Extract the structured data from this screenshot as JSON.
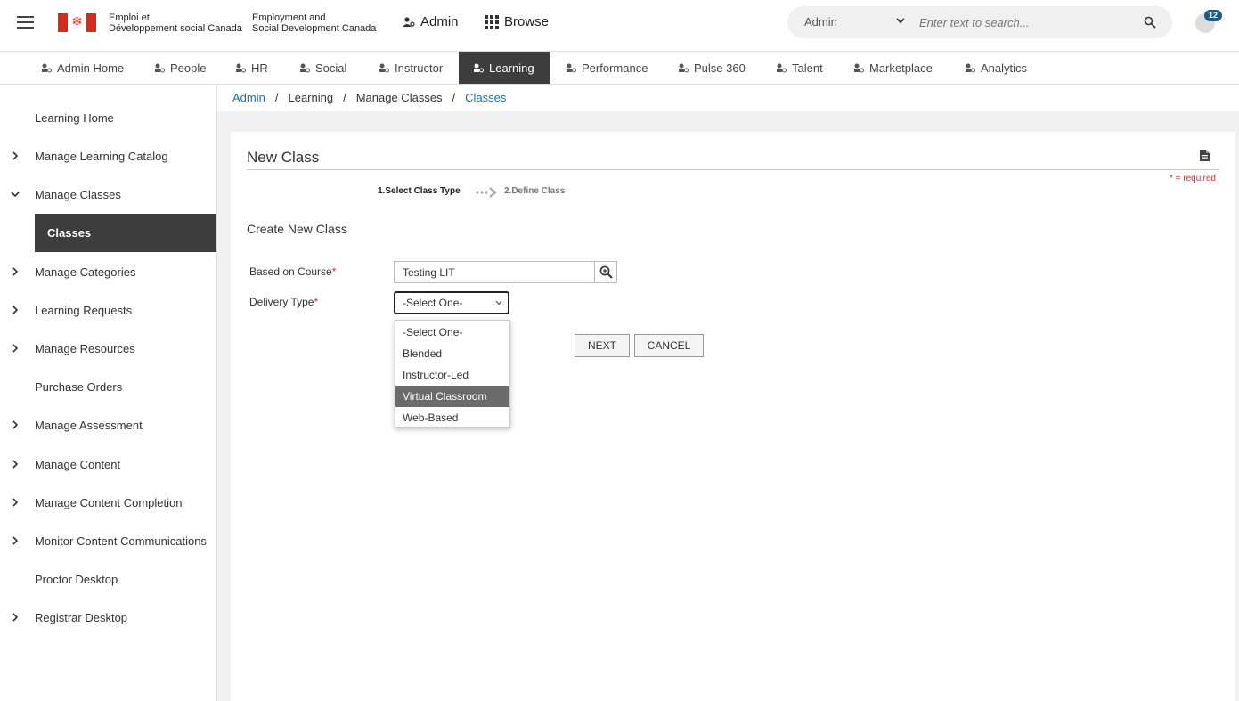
{
  "header": {
    "gov_fr_line1": "Emploi et",
    "gov_fr_line2": "Développement social Canada",
    "gov_en_line1": "Employment and",
    "gov_en_line2": "Social Development Canada",
    "admin_label": "Admin",
    "browse_label": "Browse",
    "search_scope": "Admin",
    "search_placeholder": "Enter text to search...",
    "notification_count": "12"
  },
  "nav": {
    "items": [
      {
        "label": "Admin Home",
        "icon": "admin-home-icon"
      },
      {
        "label": "People",
        "icon": "people-icon"
      },
      {
        "label": "HR",
        "icon": "hr-icon"
      },
      {
        "label": "Social",
        "icon": "social-icon"
      },
      {
        "label": "Instructor",
        "icon": "instructor-icon"
      },
      {
        "label": "Learning",
        "icon": "learning-icon",
        "active": true
      },
      {
        "label": "Performance",
        "icon": "performance-icon"
      },
      {
        "label": "Pulse 360",
        "icon": "pulse-icon"
      },
      {
        "label": "Talent",
        "icon": "talent-icon"
      },
      {
        "label": "Marketplace",
        "icon": "marketplace-icon"
      },
      {
        "label": "Analytics",
        "icon": "analytics-icon"
      }
    ]
  },
  "sidebar": {
    "items": [
      {
        "label": "Learning Home",
        "chevron": "none"
      },
      {
        "label": "Manage Learning Catalog",
        "chevron": "right"
      },
      {
        "label": "Manage Classes",
        "chevron": "down"
      },
      {
        "label": "Classes",
        "chevron": "none",
        "active": true
      },
      {
        "label": "Manage Categories",
        "chevron": "right"
      },
      {
        "label": "Learning Requests",
        "chevron": "right"
      },
      {
        "label": "Manage Resources",
        "chevron": "right"
      },
      {
        "label": "Purchase Orders",
        "chevron": "none"
      },
      {
        "label": "Manage Assessment",
        "chevron": "right"
      },
      {
        "label": "Manage Content",
        "chevron": "right"
      },
      {
        "label": "Manage Content Completion",
        "chevron": "right"
      },
      {
        "label": "Monitor Content Communications",
        "chevron": "right"
      },
      {
        "label": "Proctor Desktop",
        "chevron": "none"
      },
      {
        "label": "Registrar Desktop",
        "chevron": "right"
      }
    ]
  },
  "breadcrumb": {
    "items": [
      "Admin",
      "Learning",
      "Manage Classes",
      "Classes"
    ],
    "separator": "/"
  },
  "page": {
    "title": "New Class",
    "required_note": "* = required",
    "step1": "1.Select Class Type",
    "step2": "2.Define Class",
    "section_title": "Create New Class"
  },
  "form": {
    "course_label": "Based on Course",
    "course_value": "Testing LIT",
    "delivery_label": "Delivery Type",
    "required_mark": "*",
    "delivery_selected": "-Select One-",
    "delivery_options": [
      "-Select One-",
      "Blended",
      "Instructor-Led",
      "Virtual Classroom",
      "Web-Based"
    ],
    "highlighted_option": "Virtual Classroom",
    "next_label": "NEXT",
    "cancel_label": "CANCEL"
  },
  "colors": {
    "active_bg": "#3d3d3d",
    "link": "#1e6fa8",
    "required": "#c0392b",
    "highlight": "#6b6b6b",
    "badge": "#1d5c8a"
  }
}
